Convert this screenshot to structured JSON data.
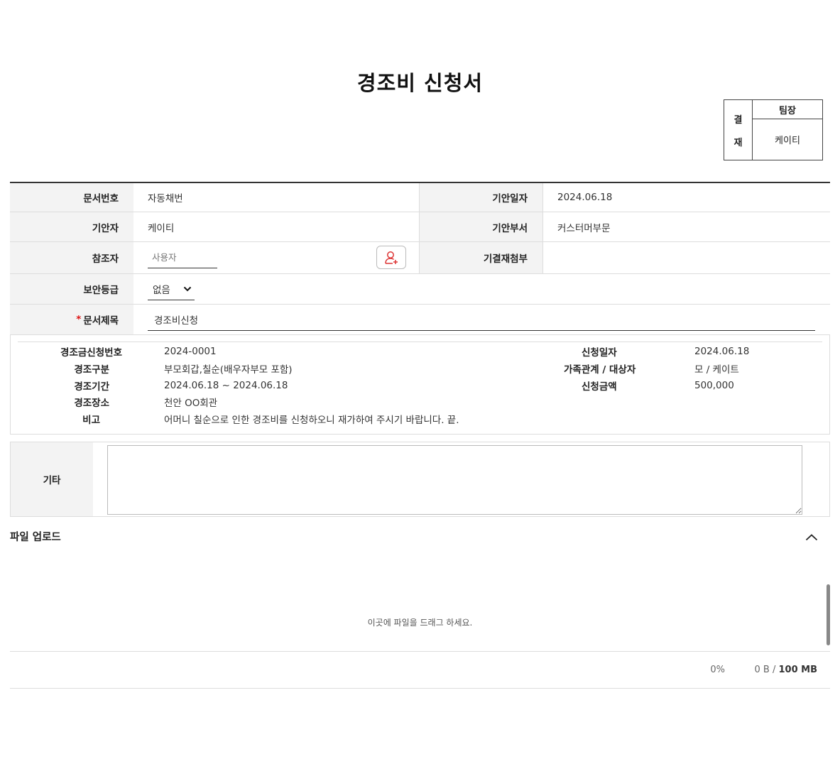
{
  "title": "경조비 신청서",
  "approval": {
    "side": [
      "결",
      "재"
    ],
    "role": "팀장",
    "name": "케이티"
  },
  "form": {
    "doc_no_label": "문서번호",
    "doc_no_value": "자동채번",
    "draft_date_label": "기안일자",
    "draft_date_value": "2024.06.18",
    "drafter_label": "기안자",
    "drafter_value": "케이티",
    "draft_dept_label": "기안부서",
    "draft_dept_value": "커스터머부문",
    "ref_label": "참조자",
    "ref_placeholder": "사용자",
    "attach_label": "기결재첨부",
    "security_label": "보안등급",
    "security_value": "없음",
    "doc_title_required": "*",
    "doc_title_label": "문서제목",
    "doc_title_value": "경조비신청"
  },
  "detail": {
    "req_no_label": "경조금신청번호",
    "req_no_value": "2024-0001",
    "type_label": "경조구분",
    "type_value": "부모회갑,칠순(배우자부모 포함)",
    "period_label": "경조기간",
    "period_value": "2024.06.18 ~ 2024.06.18",
    "place_label": "경조장소",
    "place_value": "천안 OO회관",
    "note_label": "비고",
    "note_value": "어머니 칠순으로 인한 경조비를 신청하오니 재가하여 주시기 바랍니다. 끝.",
    "req_date_label": "신청일자",
    "req_date_value": "2024.06.18",
    "family_label": "가족관계 / 대상자",
    "family_value": "모 / 케이트",
    "amount_label": "신청금액",
    "amount_value": "500,000"
  },
  "etc": {
    "label": "기타"
  },
  "upload": {
    "title": "파일 업로드",
    "hint": "이곳에 파일을 드래그 하세요.",
    "percent": "0%",
    "size_used": "0 B / ",
    "size_max": "100 MB"
  }
}
